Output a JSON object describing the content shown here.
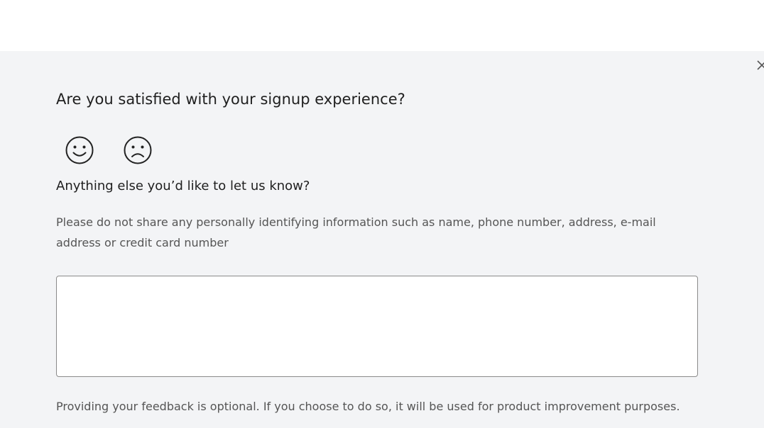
{
  "survey": {
    "question": "Are you satisfied with your signup experience?",
    "ratings": [
      {
        "icon": "smiley-face-icon",
        "meaning": "satisfied"
      },
      {
        "icon": "sad-face-icon",
        "meaning": "not satisfied"
      }
    ],
    "followup_question": "Anything else you’d like to let us know?",
    "privacy_note": "Please do not share any personally identifying information such as name, phone number, address, e-mail address or credit card number",
    "feedback_value": "",
    "optional_note": "Providing your feedback is optional. If you choose to do so, it will be used for product improvement purposes."
  },
  "colors": {
    "panel_background": "#f3f4f6",
    "text": "#1f1f1f",
    "secondary_text": "#555555",
    "input_border": "#8a8a8a"
  }
}
